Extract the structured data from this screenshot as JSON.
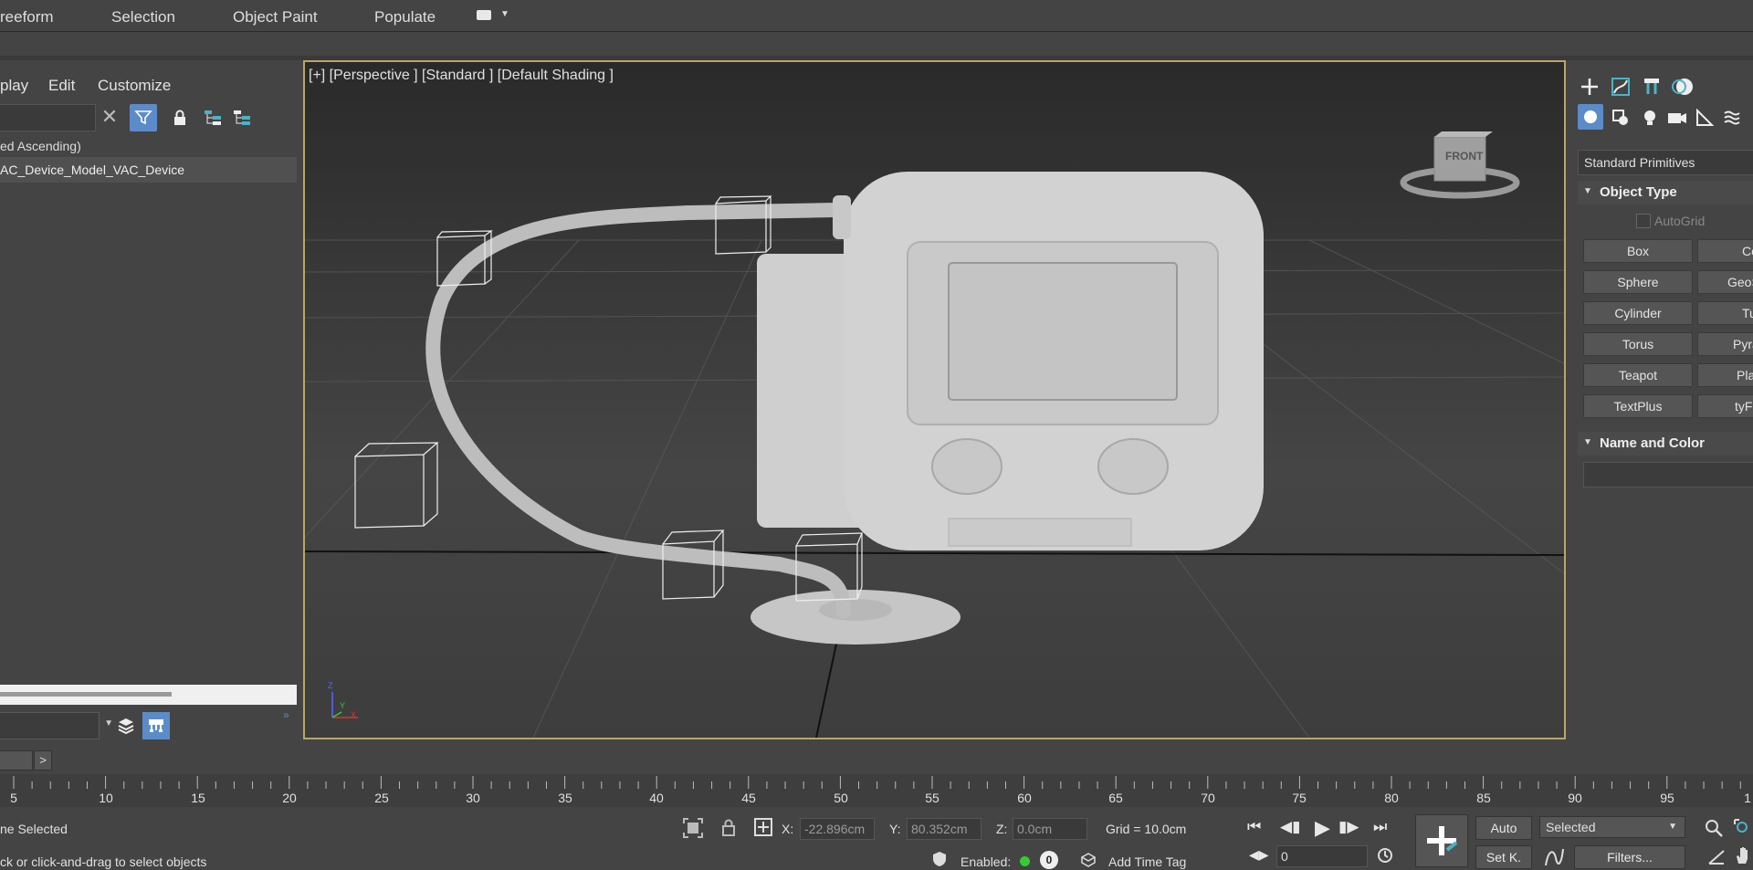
{
  "ribbon": {
    "tabs": [
      "reeform",
      "Selection",
      "Object Paint",
      "Populate"
    ]
  },
  "explorer": {
    "menus": [
      "play",
      "Edit",
      "Customize"
    ],
    "sort_label": "ed Ascending)",
    "tree_item": "AC_Device_Model_VAC_Device"
  },
  "viewport": {
    "label": "[+] [Perspective ] [Standard ] [Default Shading ]",
    "viewcube_face": "FRONT",
    "axis_labels": [
      "Z",
      "X",
      "Y"
    ]
  },
  "command_panel": {
    "primitive_type": "Standard Primitives",
    "object_type_title": "Object Type",
    "autogrid_label": "AutoGrid",
    "buttons": [
      [
        "Box",
        "Co"
      ],
      [
        "Sphere",
        "GeoS"
      ],
      [
        "Cylinder",
        "Tu"
      ],
      [
        "Torus",
        "Pyra"
      ],
      [
        "Teapot",
        "Pla"
      ],
      [
        "TextPlus",
        "tyF"
      ]
    ],
    "name_color_title": "Name and Color"
  },
  "timeline": {
    "slider_next": ">",
    "ticks": [
      "5",
      "10",
      "15",
      "20",
      "25",
      "30",
      "35",
      "40",
      "45",
      "50",
      "55",
      "60",
      "65",
      "70",
      "75",
      "80",
      "85",
      "90",
      "95",
      "1"
    ]
  },
  "status": {
    "selection_text": "ne Selected",
    "prompt_text": "ck or click-and-drag to select objects",
    "x_label": "X:",
    "x_value": "-22.896cm",
    "y_label": "Y:",
    "y_value": "80.352cm",
    "z_label": "Z:",
    "z_value": "0.0cm",
    "grid": "Grid = 10.0cm",
    "enabled_label": "Enabled:",
    "enabled_count": "0",
    "add_time_tag": "Add Time Tag",
    "frame_value": "0",
    "auto_label": "Auto",
    "setkey_label": "Set K.",
    "selected_dropdown": "Selected",
    "filters_label": "Filters..."
  }
}
